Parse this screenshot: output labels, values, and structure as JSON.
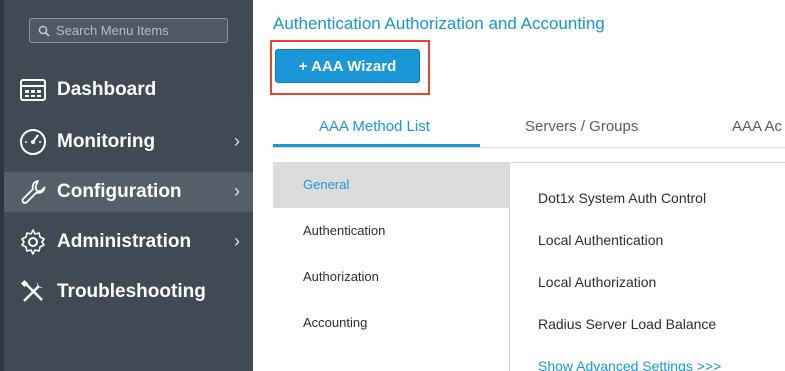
{
  "sidebar": {
    "search": {
      "placeholder": "Search Menu Items"
    },
    "items": [
      {
        "label": "Dashboard",
        "icon": "dashboard-icon",
        "has_submenu": false,
        "active": false
      },
      {
        "label": "Monitoring",
        "icon": "gauge-icon",
        "has_submenu": true,
        "chevron": "›",
        "active": false
      },
      {
        "label": "Configuration",
        "icon": "wrench-icon",
        "has_submenu": true,
        "chevron": "›",
        "active": true
      },
      {
        "label": "Administration",
        "icon": "gear-icon",
        "has_submenu": true,
        "chevron": "›",
        "active": false
      },
      {
        "label": "Troubleshooting",
        "icon": "tools-icon",
        "has_submenu": false,
        "active": false
      }
    ]
  },
  "main": {
    "title": "Authentication Authorization and Accounting",
    "wizard_button": {
      "label": "+ AAA Wizard"
    },
    "tabs": [
      {
        "label": "AAA Method List",
        "active": true
      },
      {
        "label": "Servers / Groups",
        "active": false
      },
      {
        "label": "AAA Ac",
        "active": false
      }
    ],
    "subnav": [
      {
        "label": "General",
        "active": true
      },
      {
        "label": "Authentication",
        "active": false
      },
      {
        "label": "Authorization",
        "active": false
      },
      {
        "label": "Accounting",
        "active": false
      }
    ],
    "settings": [
      {
        "label": "Dot1x System Auth Control"
      },
      {
        "label": "Local Authentication"
      },
      {
        "label": "Local Authorization"
      },
      {
        "label": "Radius Server Load Balance"
      }
    ],
    "advanced_link": "Show Advanced Settings >>>"
  },
  "colors": {
    "sidebar_bg": "#3f4a54",
    "sidebar_active": "#555f69",
    "accent": "#1a97d6",
    "highlight_box": "#e8432e"
  }
}
